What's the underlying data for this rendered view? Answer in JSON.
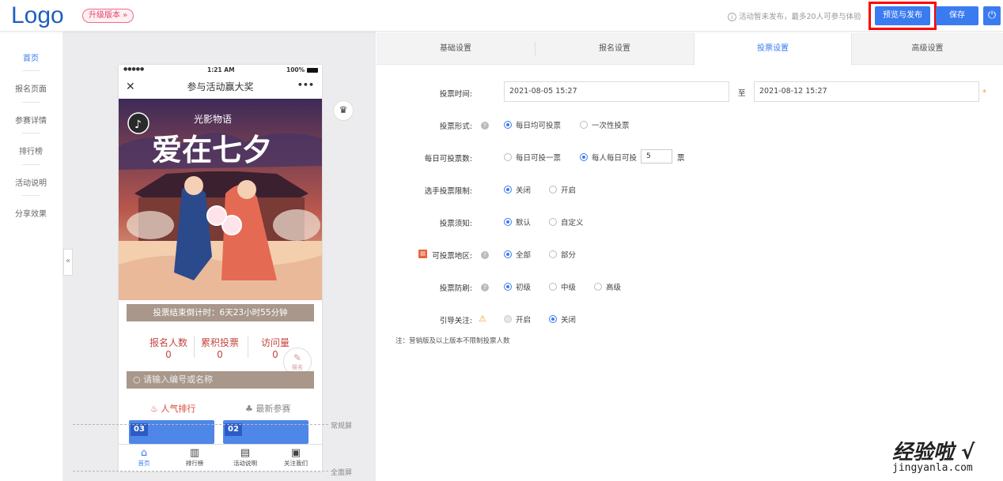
{
  "header": {
    "logo": "Logo",
    "upgrade": "升级版本 »",
    "notice": "活动暂未发布，最多20人可参与体验",
    "publish": "预览与发布",
    "save": "保存",
    "power_icon": "⏻",
    "notice_icon": "i"
  },
  "sidebar": {
    "items": [
      {
        "label": "首页"
      },
      {
        "label": "报名页面"
      },
      {
        "label": "参赛详情"
      },
      {
        "label": "排行榜"
      },
      {
        "label": "活动说明"
      },
      {
        "label": "分享效果"
      }
    ],
    "collapse": "«"
  },
  "phone": {
    "status_signal": "●●●●●",
    "status_time": "1:21 AM",
    "status_battery": "100%",
    "close": "✕",
    "title": "参与活动赢大奖",
    "more": "•••",
    "banner_small": "光影物语",
    "banner_big": "爱在七夕",
    "countdown": "投票结束倒计时：6天23小时55分钟",
    "stats": [
      {
        "label": "报名人数",
        "value": "0"
      },
      {
        "label": "累积投票",
        "value": "0"
      },
      {
        "label": "访问量",
        "value": "0"
      }
    ],
    "search_placeholder": "请输入编号或名称",
    "tab_popular": "人气排行",
    "tab_latest": "最新参赛",
    "cards": [
      "03",
      "02"
    ],
    "enroll": "报名",
    "bottom_nav": [
      {
        "label": "首页"
      },
      {
        "label": "排行榜"
      },
      {
        "label": "活动说明"
      },
      {
        "label": "关注我们"
      }
    ]
  },
  "screens": {
    "normal": "常规屏",
    "full": "全面屏"
  },
  "tabs": [
    "基础设置",
    "报名设置",
    "投票设置",
    "高级设置"
  ],
  "active_tab": "投票设置",
  "form": {
    "vote_time_label": "投票时间:",
    "start": "2021-08-05 15:27",
    "to": "至",
    "end": "2021-08-12 15:27",
    "required": "*",
    "vote_form_label": "投票形式:",
    "vote_form_opts": [
      "每日均可投票",
      "一次性投票"
    ],
    "daily_label": "每日可投票数:",
    "daily_opts": [
      "每日可投一票",
      "每人每日可投"
    ],
    "daily_count": "5",
    "daily_unit": "票",
    "limit_label": "选手投票限制:",
    "limit_opts": [
      "关闭",
      "开启"
    ],
    "notice_label": "投票须知:",
    "notice_opts": [
      "默认",
      "自定义"
    ],
    "region_label": "可投票地区:",
    "region_opts": [
      "全部",
      "部分"
    ],
    "brush_label": "投票防刷:",
    "brush_opts": [
      "初级",
      "中级",
      "高级"
    ],
    "guide_label": "引导关注:",
    "guide_opts": [
      "开启",
      "关闭"
    ],
    "note": "注：营销版及以上版本不限制投票人数"
  },
  "watermark": {
    "main": "经验啦 √",
    "sub": "jingyanla.com"
  }
}
